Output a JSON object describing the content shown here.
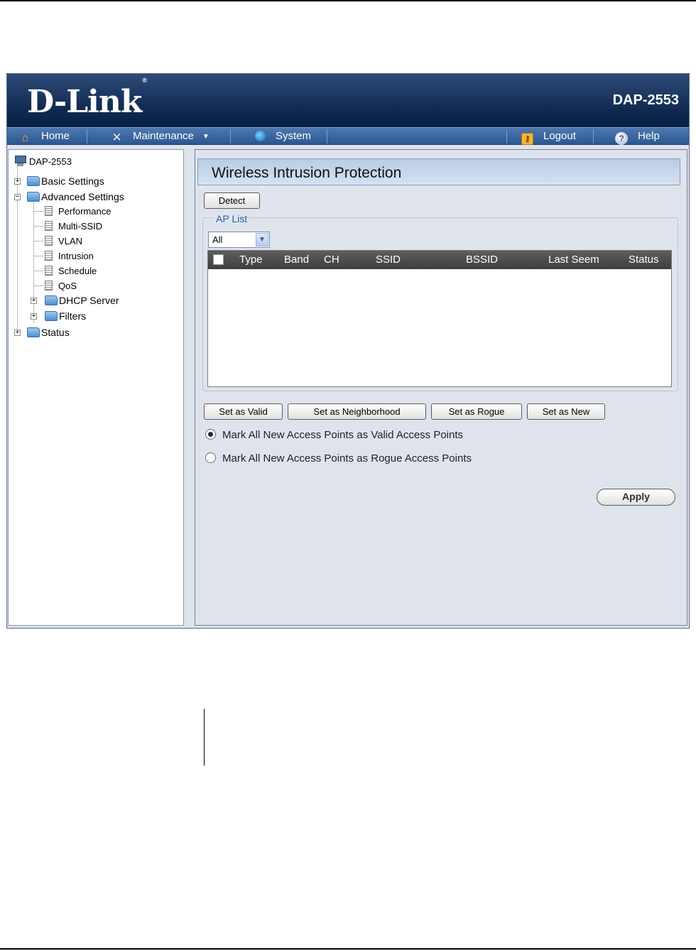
{
  "header": {
    "brand": "D-Link",
    "registered_mark": "®",
    "model": "DAP-2553"
  },
  "nav": {
    "home": "Home",
    "maintenance": "Maintenance",
    "system": "System",
    "logout": "Logout",
    "help": "Help"
  },
  "sidebar": {
    "root": "DAP-2553",
    "basic_settings": "Basic Settings",
    "advanced_settings": "Advanced Settings",
    "advanced_items": [
      "Performance",
      "Multi-SSID",
      "VLAN",
      "Intrusion",
      "Schedule",
      "QoS"
    ],
    "dhcp_server": "DHCP Server",
    "filters": "Filters",
    "status": "Status"
  },
  "main": {
    "title": "Wireless Intrusion Protection",
    "detect_button": "Detect",
    "ap_list_legend": "AP List",
    "filter_select": {
      "value": "All"
    },
    "table": {
      "columns": [
        "Type",
        "Band",
        "CH",
        "SSID",
        "BSSID",
        "Last Seem",
        "Status"
      ],
      "rows": []
    },
    "actions": [
      "Set as Valid",
      "Set as Neighborhood",
      "Set as Rogue",
      "Set as New"
    ],
    "radio_options": [
      {
        "label": "Mark All New Access Points as Valid Access Points",
        "selected": true
      },
      {
        "label": "Mark All New Access Points as Rogue Access Points",
        "selected": false
      }
    ],
    "apply_button": "Apply"
  }
}
